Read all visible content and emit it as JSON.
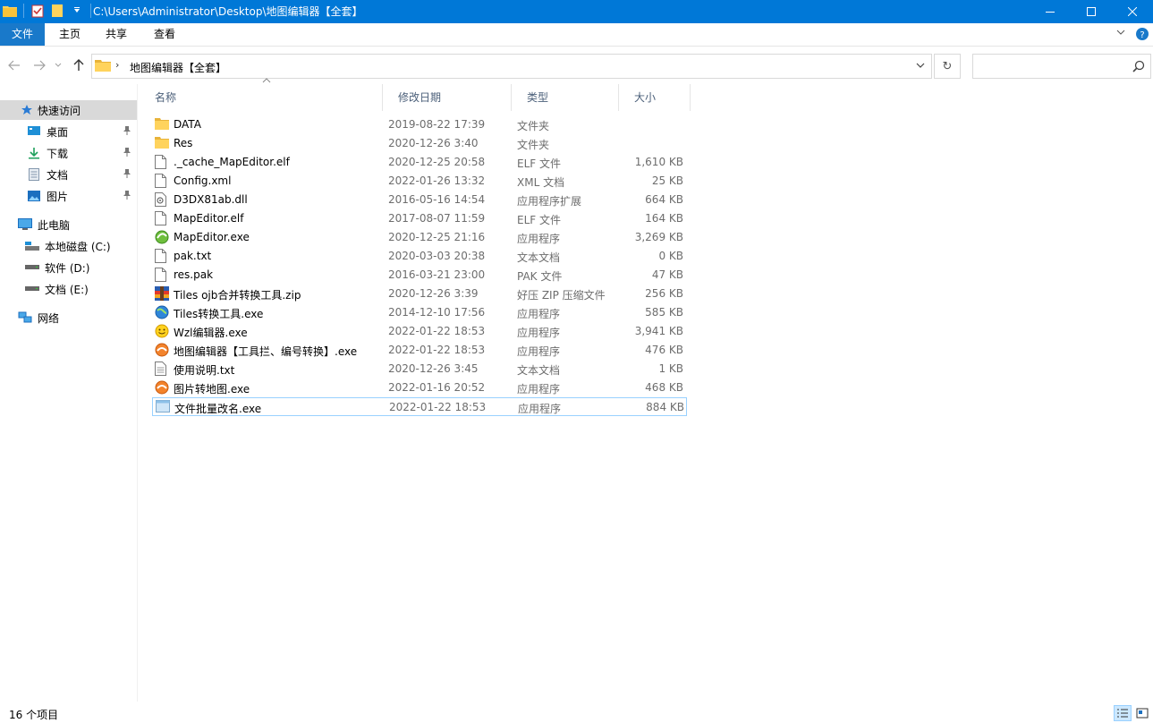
{
  "window": {
    "title": "C:\\Users\\Administrator\\Desktop\\地图编辑器【全套】",
    "accent": "#0078d7"
  },
  "ribbon": {
    "tabs": [
      "文件",
      "主页",
      "共享",
      "查看"
    ]
  },
  "address": {
    "path": "地图编辑器【全套】"
  },
  "search": {
    "placeholder": ""
  },
  "nav": {
    "quick_access": "快速访问",
    "pinned": [
      {
        "label": "桌面",
        "icon": "desktop-icon"
      },
      {
        "label": "下载",
        "icon": "download-icon"
      },
      {
        "label": "文档",
        "icon": "documents-icon"
      },
      {
        "label": "图片",
        "icon": "pictures-icon"
      }
    ],
    "this_pc": "此电脑",
    "drives": [
      {
        "label": "本地磁盘 (C:)"
      },
      {
        "label": "软件 (D:)"
      },
      {
        "label": "文档 (E:)"
      }
    ],
    "network": "网络"
  },
  "columns": {
    "name": "名称",
    "date": "修改日期",
    "type": "类型",
    "size": "大小"
  },
  "files": [
    {
      "name": "DATA",
      "date": "2019-08-22 17:39",
      "type": "文件夹",
      "size": "",
      "icon": "folder-icon"
    },
    {
      "name": "Res",
      "date": "2020-12-26 3:40",
      "type": "文件夹",
      "size": "",
      "icon": "folder-icon"
    },
    {
      "name": "._cache_MapEditor.elf",
      "date": "2020-12-25 20:58",
      "type": "ELF 文件",
      "size": "1,610 KB",
      "icon": "file-icon"
    },
    {
      "name": "Config.xml",
      "date": "2022-01-26 13:32",
      "type": "XML 文档",
      "size": "25 KB",
      "icon": "file-icon"
    },
    {
      "name": "D3DX81ab.dll",
      "date": "2016-05-16 14:54",
      "type": "应用程序扩展",
      "size": "664 KB",
      "icon": "dll-icon"
    },
    {
      "name": "MapEditor.elf",
      "date": "2017-08-07 11:59",
      "type": "ELF 文件",
      "size": "164 KB",
      "icon": "file-icon"
    },
    {
      "name": "MapEditor.exe",
      "date": "2020-12-25 21:16",
      "type": "应用程序",
      "size": "3,269 KB",
      "icon": "mapeditor-exe-icon"
    },
    {
      "name": "pak.txt",
      "date": "2020-03-03 20:38",
      "type": "文本文档",
      "size": "0 KB",
      "icon": "file-icon"
    },
    {
      "name": "res.pak",
      "date": "2016-03-21 23:00",
      "type": "PAK 文件",
      "size": "47 KB",
      "icon": "file-icon"
    },
    {
      "name": "Tiles ojb合并转换工具.zip",
      "date": "2020-12-26 3:39",
      "type": "好压 ZIP 压缩文件",
      "size": "256 KB",
      "icon": "zip-icon"
    },
    {
      "name": "Tiles转换工具.exe",
      "date": "2014-12-10 17:56",
      "type": "应用程序",
      "size": "585 KB",
      "icon": "globe-exe-icon"
    },
    {
      "name": "Wzl编辑器.exe",
      "date": "2022-01-22 18:53",
      "type": "应用程序",
      "size": "3,941 KB",
      "icon": "smiley-exe-icon"
    },
    {
      "name": "地图编辑器【工具拦、编号转换】.exe",
      "date": "2022-01-22 18:53",
      "type": "应用程序",
      "size": "476 KB",
      "icon": "orange-exe-icon"
    },
    {
      "name": "使用说明.txt",
      "date": "2020-12-26 3:45",
      "type": "文本文档",
      "size": "1 KB",
      "icon": "text-file-icon"
    },
    {
      "name": "图片转地图.exe",
      "date": "2022-01-16 20:52",
      "type": "应用程序",
      "size": "468 KB",
      "icon": "orange-exe-icon"
    },
    {
      "name": "文件批量改名.exe",
      "date": "2022-01-22 18:53",
      "type": "应用程序",
      "size": "884 KB",
      "icon": "window-exe-icon"
    }
  ],
  "status": {
    "count": "16 个项目"
  }
}
